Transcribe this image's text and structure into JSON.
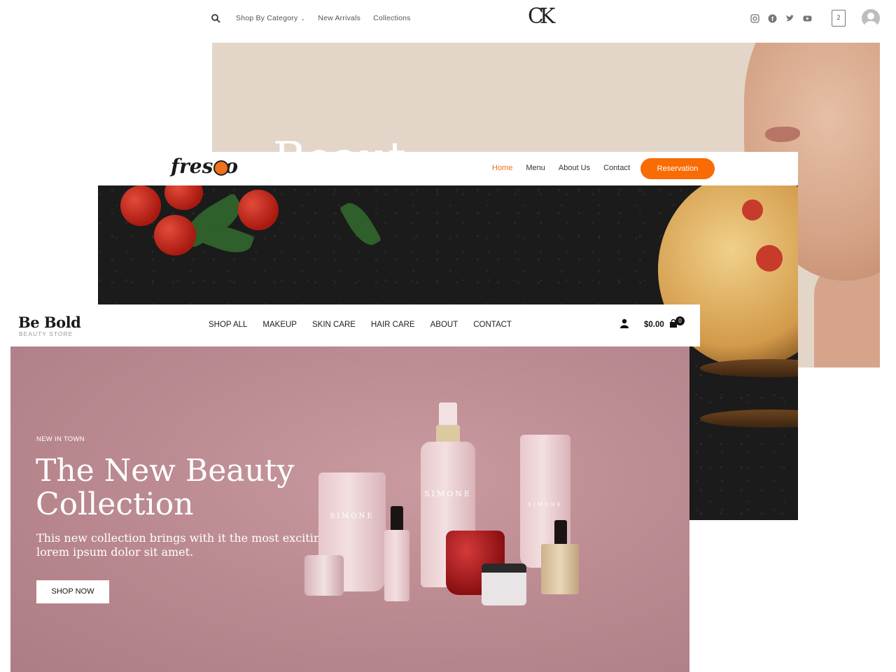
{
  "ck_site": {
    "logo": "CK",
    "nav": [
      {
        "label": "Shop By Category",
        "dropdown": true
      },
      {
        "label": "New Arrivals"
      },
      {
        "label": "Collections"
      }
    ],
    "cart_count": "2",
    "social_icons": [
      "instagram-icon",
      "facebook-icon",
      "twitter-icon",
      "youtube-icon"
    ],
    "hero_headline_partial": "Beaut"
  },
  "fresco_site": {
    "logo": "fresco",
    "nav": [
      {
        "label": "Home",
        "active": true
      },
      {
        "label": "Menu"
      },
      {
        "label": "About Us"
      },
      {
        "label": "Contact"
      }
    ],
    "cta_label": "Reservation",
    "accent_color": "#f96b04"
  },
  "bebold_site": {
    "logo": "Be Bold",
    "tagline": "BEAUTY STORE",
    "nav": [
      "SHOP ALL",
      "MAKEUP",
      "SKIN CARE",
      "HAIR CARE",
      "ABOUT",
      "CONTACT"
    ],
    "cart_total": "$0.00",
    "cart_count": "0",
    "hero": {
      "eyebrow": "NEW IN TOWN",
      "title": "The New Beauty Collection",
      "subtitle": "This new collection brings with it the most exciting lorem ipsum dolor sit amet.",
      "cta": "SHOP NOW",
      "product_brand": "SIMONE",
      "bg_color": "#bb8a91"
    }
  }
}
